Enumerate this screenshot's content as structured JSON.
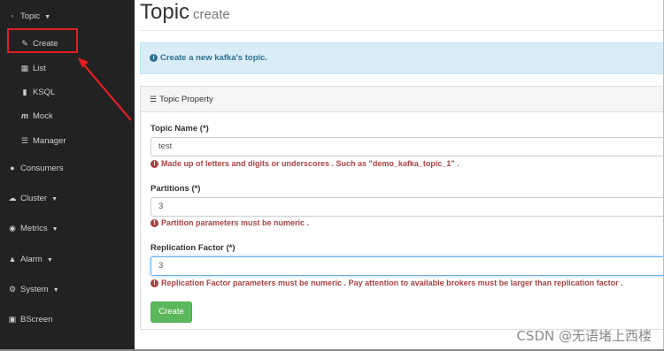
{
  "sidebar": {
    "topic": {
      "icon": "comments-icon",
      "label": "Topic"
    },
    "sub_items": [
      {
        "icon": "edit-icon",
        "label": "Create"
      },
      {
        "icon": "table-icon",
        "label": "List"
      },
      {
        "icon": "file-icon",
        "label": "KSQL"
      },
      {
        "icon": "mock-icon",
        "label": "Mock"
      },
      {
        "icon": "tasks-icon",
        "label": "Manager"
      }
    ],
    "consumers": {
      "icon": "users-icon",
      "label": "Consumers"
    },
    "cluster": {
      "icon": "cloud-icon",
      "label": "Cluster"
    },
    "metrics": {
      "icon": "eye-icon",
      "label": "Metrics"
    },
    "alarm": {
      "icon": "bell-icon",
      "label": "Alarm"
    },
    "system": {
      "icon": "gear-icon",
      "label": "System"
    },
    "bscreen": {
      "icon": "desktop-icon",
      "label": "BScreen"
    }
  },
  "header": {
    "title": "Topic",
    "subtitle": "create"
  },
  "alert": {
    "text": "Create a new kafka's topic."
  },
  "panel": {
    "title": "Topic Property",
    "fields": {
      "topic_name": {
        "label": "Topic Name (*)",
        "value": "test",
        "help": "Made up of letters and digits or underscores . Such as \"demo_kafka_topic_1\" ."
      },
      "partitions": {
        "label": "Partitions (*)",
        "value": "3",
        "help": "Partition parameters must be numeric ."
      },
      "replication": {
        "label": "Replication Factor (*)",
        "value": "3",
        "help": "Replication Factor parameters must be numeric . Pay attention to available brokers must be larger than replication factor ."
      }
    },
    "submit_label": "Create"
  },
  "watermark": "CSDN @无语堵上西楼",
  "colors": {
    "sidebar_bg": "#222222",
    "highlight_red": "#e01e24",
    "alert_bg": "#d9edf7",
    "alert_text": "#31708f",
    "error_text": "#a94442",
    "button_green": "#5cb85c"
  }
}
